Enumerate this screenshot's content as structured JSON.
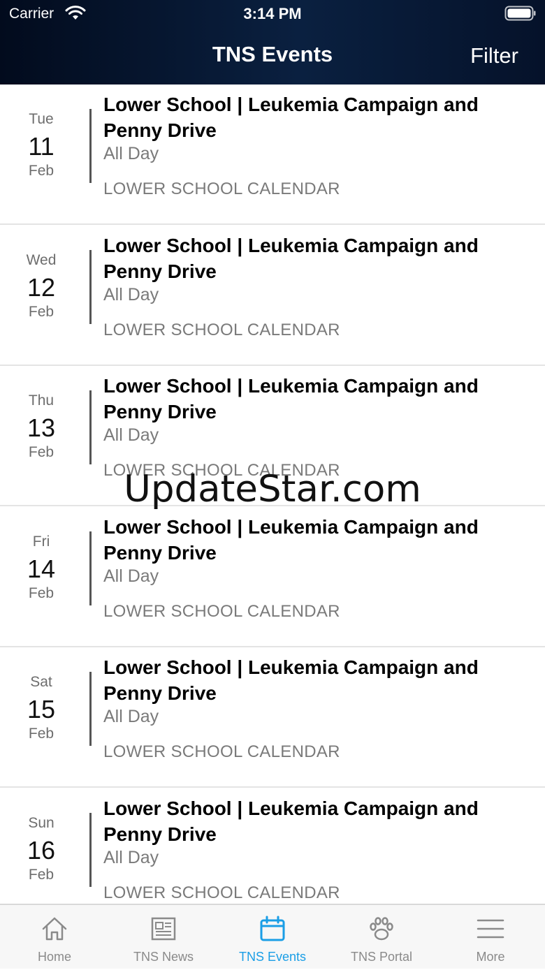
{
  "status_bar": {
    "carrier": "Carrier",
    "time": "3:14 PM"
  },
  "nav": {
    "title": "TNS Events",
    "filter_label": "Filter"
  },
  "events": [
    {
      "day_of_week": "Tue",
      "day": "11",
      "month": "Feb",
      "title": "Lower School | Leukemia Campaign and Penny Drive",
      "time": "All Day",
      "calendar": "LOWER SCHOOL CALENDAR"
    },
    {
      "day_of_week": "Wed",
      "day": "12",
      "month": "Feb",
      "title": "Lower School | Leukemia Campaign and Penny Drive",
      "time": "All Day",
      "calendar": "LOWER SCHOOL CALENDAR"
    },
    {
      "day_of_week": "Thu",
      "day": "13",
      "month": "Feb",
      "title": "Lower School | Leukemia Campaign and Penny Drive",
      "time": "All Day",
      "calendar": "LOWER SCHOOL CALENDAR"
    },
    {
      "day_of_week": "Fri",
      "day": "14",
      "month": "Feb",
      "title": "Lower School | Leukemia Campaign and Penny Drive",
      "time": "All Day",
      "calendar": "LOWER SCHOOL CALENDAR"
    },
    {
      "day_of_week": "Sat",
      "day": "15",
      "month": "Feb",
      "title": "Lower School | Leukemia Campaign and Penny Drive",
      "time": "All Day",
      "calendar": "LOWER SCHOOL CALENDAR"
    },
    {
      "day_of_week": "Sun",
      "day": "16",
      "month": "Feb",
      "title": "Lower School | Leukemia Campaign and Penny Drive",
      "time": "All Day",
      "calendar": "LOWER SCHOOL CALENDAR"
    }
  ],
  "watermark": "UpdateStar.com",
  "tabs": [
    {
      "label": "Home",
      "icon": "home-icon"
    },
    {
      "label": "TNS News",
      "icon": "newspaper-icon"
    },
    {
      "label": "TNS Events",
      "icon": "calendar-icon",
      "active": true
    },
    {
      "label": "TNS Portal",
      "icon": "paw-icon"
    },
    {
      "label": "More",
      "icon": "menu-icon"
    }
  ],
  "colors": {
    "header": "#0a2040",
    "active_tab": "#1a9ee6",
    "inactive_tab": "#8a8a8a"
  }
}
